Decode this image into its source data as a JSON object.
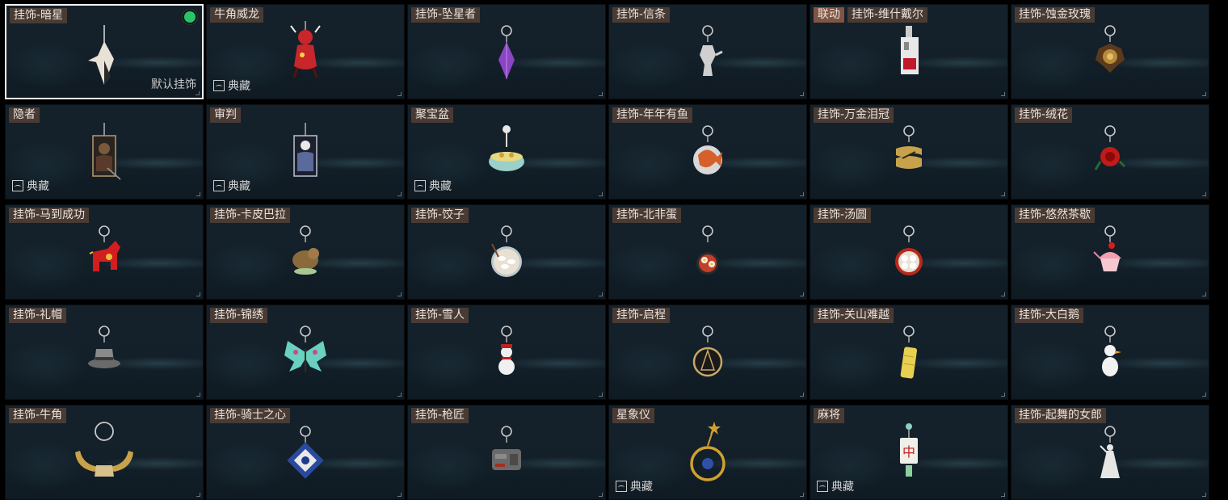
{
  "default_label": "默认挂饰",
  "collection_label": "典藏",
  "items": [
    {
      "title": "挂饰-暗星",
      "collab": null,
      "selected": true,
      "collection": false,
      "color": "#e8e2d6",
      "icon": "dark-star-charm-icon"
    },
    {
      "title": "牛角威龙",
      "collab": null,
      "selected": false,
      "collection": true,
      "color": "#c8262a",
      "icon": "dragon-charm-icon"
    },
    {
      "title": "挂饰-坠星者",
      "collab": null,
      "selected": false,
      "collection": false,
      "color": "#8b45c4",
      "icon": "star-crystal-charm-icon"
    },
    {
      "title": "挂饰-信条",
      "collab": null,
      "selected": false,
      "collection": false,
      "color": "#cfcfcf",
      "icon": "creed-charm-icon"
    },
    {
      "title": "挂饰-维什戴尔",
      "collab": "联动",
      "selected": false,
      "collection": false,
      "color": "#c01a2a",
      "icon": "wisadel-charm-icon"
    },
    {
      "title": "挂饰-蚀金玫瑰",
      "collab": null,
      "selected": false,
      "collection": false,
      "color": "#b88a3a",
      "icon": "golden-rose-charm-icon"
    },
    {
      "title": "隐者",
      "collab": null,
      "selected": false,
      "collection": true,
      "color": "#7a5a3a",
      "icon": "hermit-card-charm-icon"
    },
    {
      "title": "审判",
      "collab": null,
      "selected": false,
      "collection": true,
      "color": "#5a6a9a",
      "icon": "judgement-card-charm-icon"
    },
    {
      "title": "聚宝盆",
      "collab": null,
      "selected": false,
      "collection": true,
      "color": "#9ad0c8",
      "icon": "treasure-bowl-charm-icon"
    },
    {
      "title": "挂饰-年年有鱼",
      "collab": null,
      "selected": false,
      "collection": false,
      "color": "#d6602a",
      "icon": "fish-charm-icon"
    },
    {
      "title": "挂饰-万金泪冠",
      "collab": null,
      "selected": false,
      "collection": false,
      "color": "#c8a24a",
      "icon": "gold-crown-charm-icon"
    },
    {
      "title": "挂饰-绒花",
      "collab": null,
      "selected": false,
      "collection": false,
      "color": "#c21a1a",
      "icon": "velvet-flower-charm-icon"
    },
    {
      "title": "挂饰-马到成功",
      "collab": null,
      "selected": false,
      "collection": false,
      "color": "#d21e1e",
      "icon": "horse-charm-icon"
    },
    {
      "title": "挂饰-卡皮巴拉",
      "collab": null,
      "selected": false,
      "collection": false,
      "color": "#8a6a3a",
      "icon": "capybara-charm-icon"
    },
    {
      "title": "挂饰-饺子",
      "collab": null,
      "selected": false,
      "collection": false,
      "color": "#e8e0d2",
      "icon": "dumpling-charm-icon"
    },
    {
      "title": "挂饰-北非蛋",
      "collab": null,
      "selected": false,
      "collection": false,
      "color": "#c0402a",
      "icon": "shakshuka-charm-icon"
    },
    {
      "title": "挂饰-汤圆",
      "collab": null,
      "selected": false,
      "collection": false,
      "color": "#b8281c",
      "icon": "tangyuan-charm-icon"
    },
    {
      "title": "挂饰-悠然茶歇",
      "collab": null,
      "selected": false,
      "collection": false,
      "color": "#f0a0b0",
      "icon": "cupcake-charm-icon"
    },
    {
      "title": "挂饰-礼帽",
      "collab": null,
      "selected": false,
      "collection": false,
      "color": "#8a8a8a",
      "icon": "top-hat-charm-icon"
    },
    {
      "title": "挂饰-锦绣",
      "collab": null,
      "selected": false,
      "collection": false,
      "color": "#6ad0c0",
      "icon": "butterfly-charm-icon"
    },
    {
      "title": "挂饰-雪人",
      "collab": null,
      "selected": false,
      "collection": false,
      "color": "#f0f0f0",
      "icon": "snowman-charm-icon"
    },
    {
      "title": "挂饰-启程",
      "collab": null,
      "selected": false,
      "collection": false,
      "color": "#c8a868",
      "icon": "compass-charm-icon"
    },
    {
      "title": "挂饰-关山难越",
      "collab": null,
      "selected": false,
      "collection": false,
      "color": "#e8d050",
      "icon": "yellow-bar-charm-icon"
    },
    {
      "title": "挂饰-大白鹅",
      "collab": null,
      "selected": false,
      "collection": false,
      "color": "#f2f2f2",
      "icon": "goose-charm-icon"
    },
    {
      "title": "挂饰-牛角",
      "collab": null,
      "selected": false,
      "collection": false,
      "color": "#c8a24a",
      "icon": "bull-horn-charm-icon"
    },
    {
      "title": "挂饰-骑士之心",
      "collab": null,
      "selected": false,
      "collection": false,
      "color": "#2a4aa0",
      "icon": "knight-heart-charm-icon"
    },
    {
      "title": "挂饰-枪匠",
      "collab": null,
      "selected": false,
      "collection": false,
      "color": "#6a6a6a",
      "icon": "gunsmith-charm-icon"
    },
    {
      "title": "星象仪",
      "collab": null,
      "selected": false,
      "collection": true,
      "color": "#d0a030",
      "icon": "planetarium-charm-icon"
    },
    {
      "title": "麻将",
      "collab": null,
      "selected": false,
      "collection": true,
      "color": "#f0f0ea",
      "icon": "mahjong-charm-icon"
    },
    {
      "title": "挂饰-起舞的女郎",
      "collab": null,
      "selected": false,
      "collection": false,
      "color": "#e6e6e6",
      "icon": "dancer-charm-icon"
    }
  ]
}
